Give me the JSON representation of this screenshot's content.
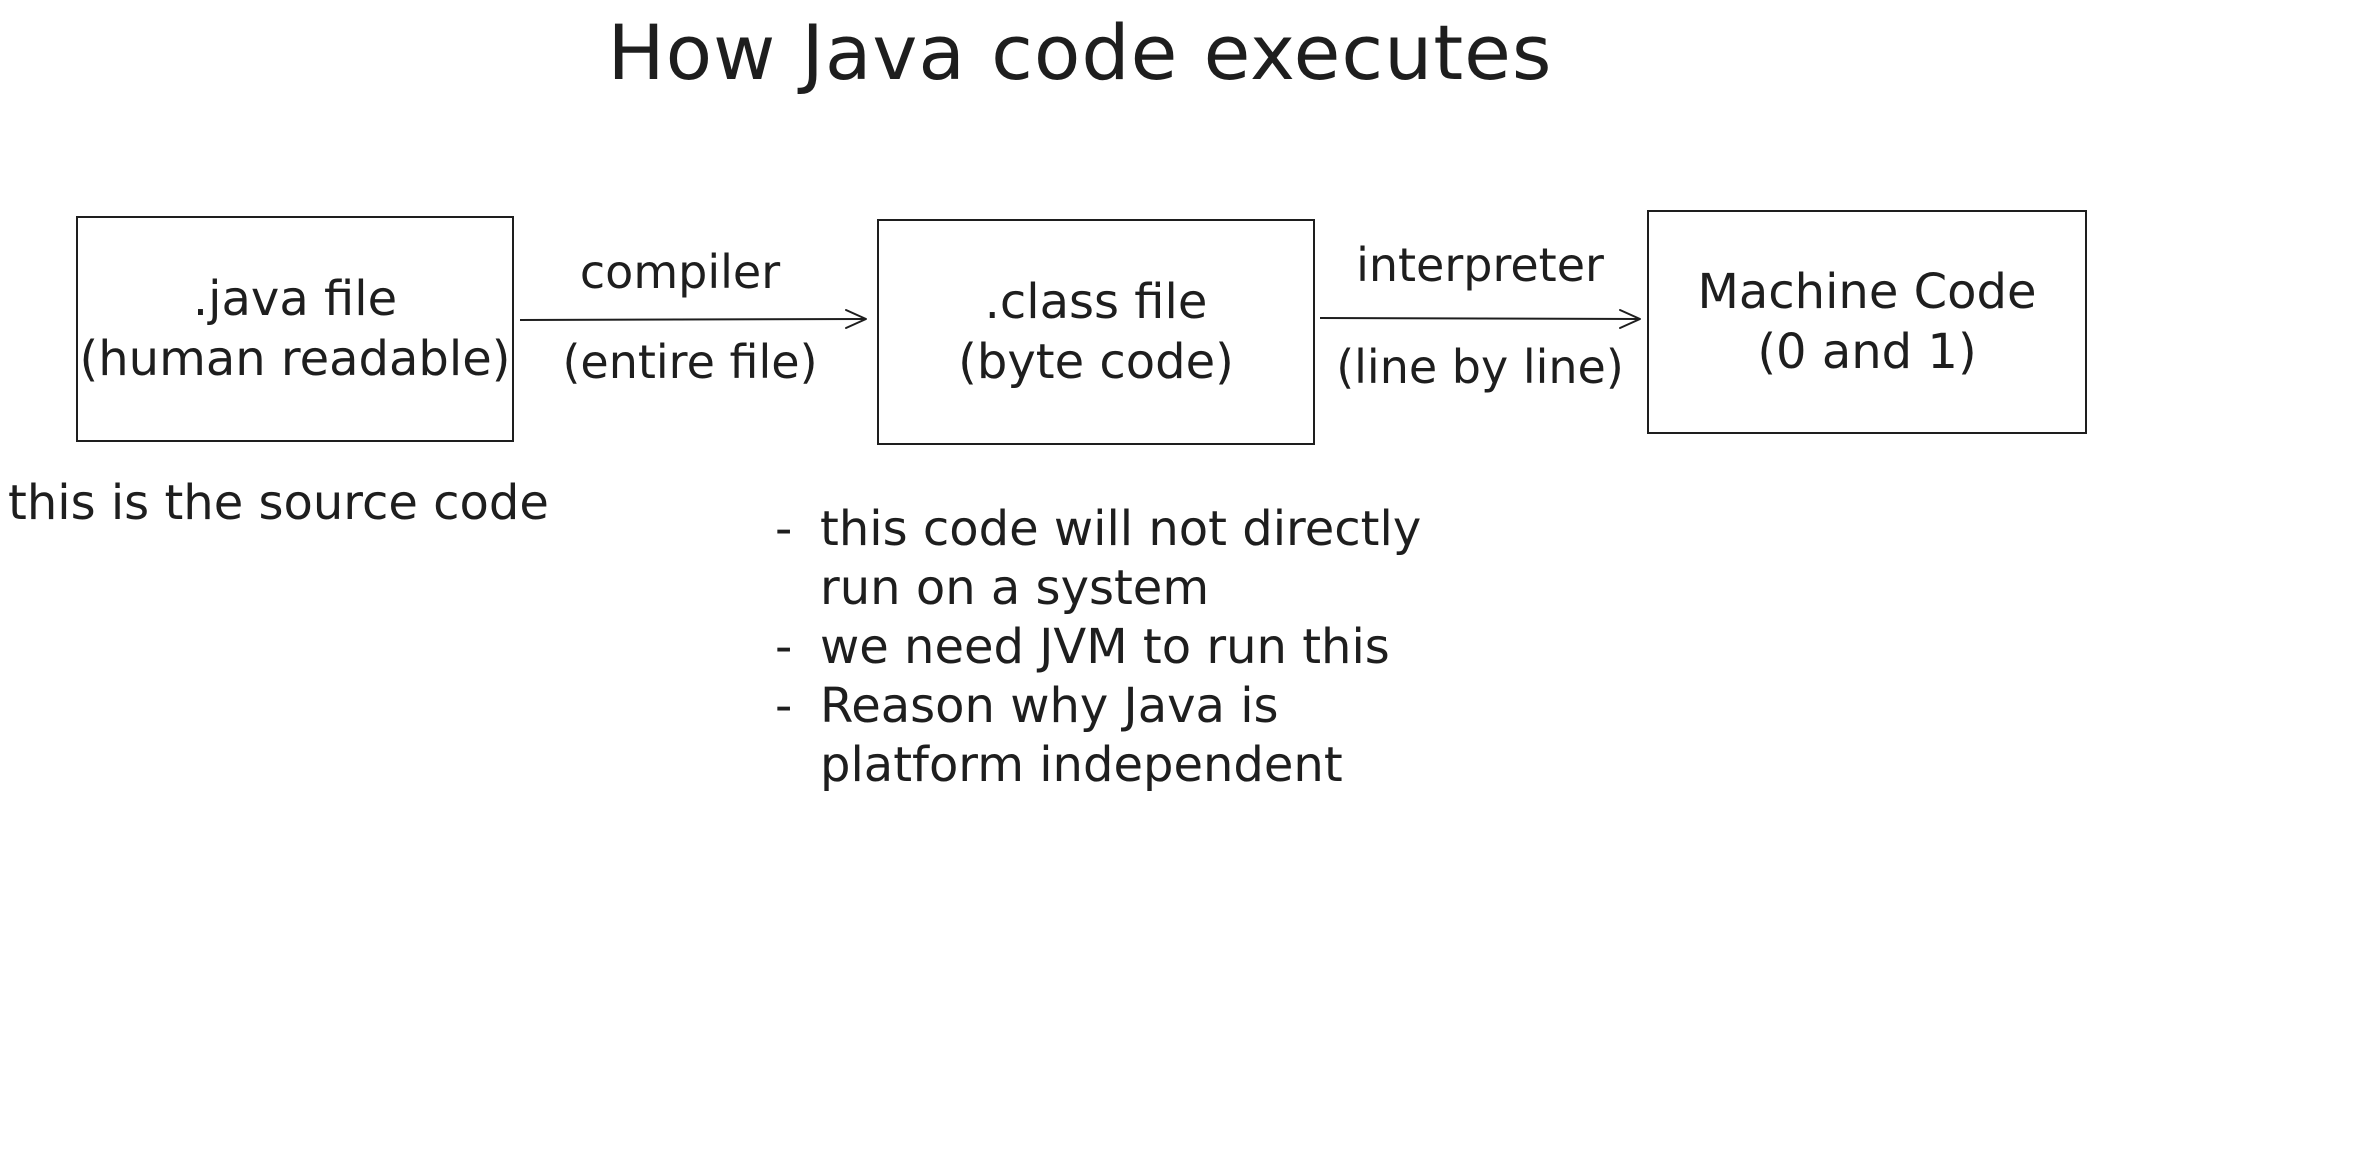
{
  "title": "How Java code executes",
  "nodes": [
    {
      "id": "java",
      "line1": ".java file",
      "line2": "(human readable)"
    },
    {
      "id": "class",
      "line1": ".class file",
      "line2": "(byte code)"
    },
    {
      "id": "machine",
      "line1": "Machine Code",
      "line2": "(0 and 1)"
    }
  ],
  "edges": [
    {
      "from": "java",
      "to": "class",
      "label_top": "compiler",
      "label_bottom": "(entire file)"
    },
    {
      "from": "class",
      "to": "machine",
      "label_top": "interpreter",
      "label_bottom": "(line by line)"
    }
  ],
  "notes": {
    "source": "this is the source code",
    "bytecode_bullets": [
      {
        "line1": "this code will not directly",
        "line2": "run on a system"
      },
      {
        "line1": "we need JVM to run this",
        "line2": ""
      },
      {
        "line1": "Reason why Java is",
        "line2": "platform independent"
      }
    ],
    "bullet_marker": "-"
  },
  "colors": {
    "stroke": "#1e1e1e",
    "background": "#ffffff"
  }
}
